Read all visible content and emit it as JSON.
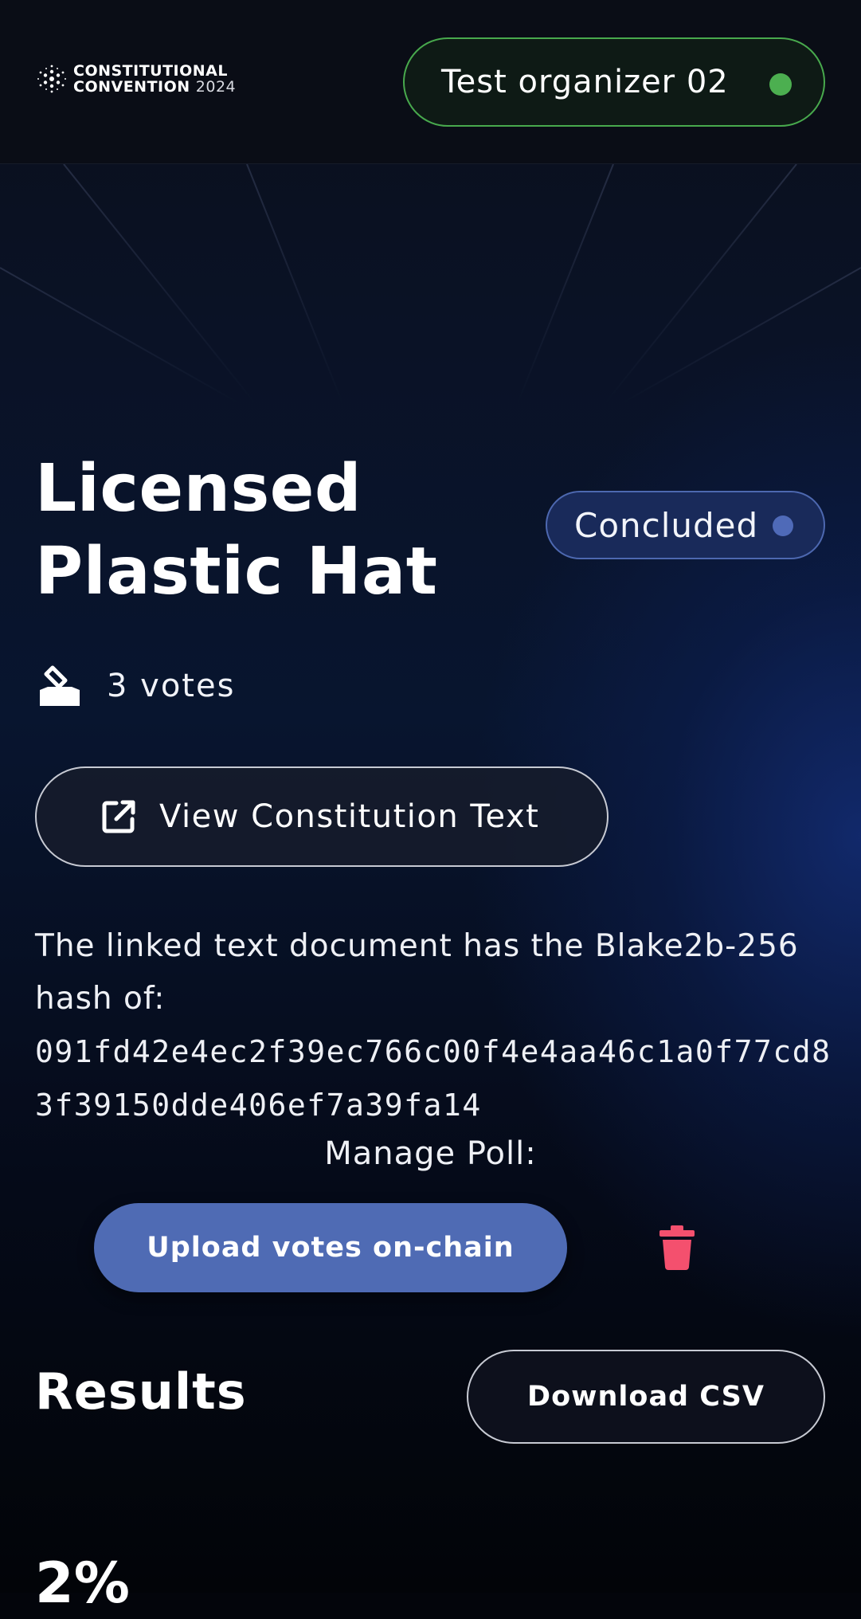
{
  "header": {
    "logo": {
      "line1": "CONSTITUTIONAL",
      "line2_word": "CONVENTION",
      "line2_year": "2024"
    },
    "organizer": {
      "label": "Test organizer 02",
      "status_color": "#4caf50"
    }
  },
  "poll": {
    "title_line1": "Licensed",
    "title_line2": "Plastic Hat",
    "status": {
      "label": "Concluded",
      "dot_color": "#4f6ab8"
    },
    "votes_label": "3 votes",
    "view_button_label": "View Constitution Text",
    "hash_intro": "The linked text document has the Blake2b-256 hash of:",
    "hash_value": "091fd42e4ec2f39ec766c00f4e4aa46c1a0f77cd83f39150dde406ef7a39fa14",
    "manage_label": "Manage Poll:",
    "upload_button_label": "Upload votes on-chain",
    "delete_icon": "trash-icon",
    "delete_color": "#f4506e"
  },
  "results": {
    "title": "Results",
    "download_button_label": "Download CSV",
    "first_percent": "2%"
  },
  "colors": {
    "accent_blue": "#4f6bb4",
    "organizer_border": "#48a94d",
    "background": "#03050b"
  }
}
